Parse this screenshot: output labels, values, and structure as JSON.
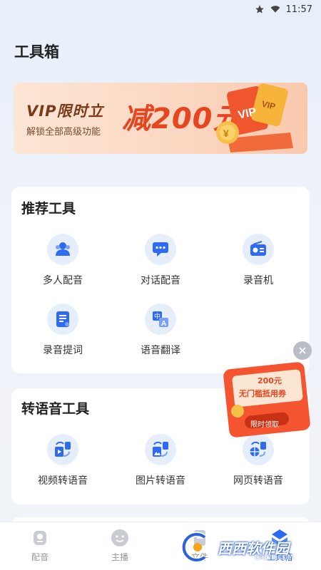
{
  "status_bar": {
    "time": "11:57"
  },
  "page": {
    "title": "工具箱"
  },
  "banner": {
    "headline": "VIP限时立",
    "subtitle": "解锁全部高级功能",
    "promo": "减200元",
    "badge_text": "VIP"
  },
  "recommended": {
    "title": "推荐工具",
    "items": [
      {
        "label": "多人配音",
        "icon": "multi-person-icon"
      },
      {
        "label": "对话配音",
        "icon": "chat-bubble-icon"
      },
      {
        "label": "录音机",
        "icon": "recorder-icon"
      },
      {
        "label": "录音提词",
        "icon": "teleprompter-icon"
      },
      {
        "label": "语音翻译",
        "icon": "translate-icon"
      }
    ]
  },
  "to_speech": {
    "title": "转语音工具",
    "items": [
      {
        "label": "视频转语音",
        "icon": "video-to-speech-icon"
      },
      {
        "label": "图片转语音",
        "icon": "image-to-speech-icon"
      },
      {
        "label": "网页转语音",
        "icon": "web-to-speech-icon"
      }
    ]
  },
  "float_ad": {
    "amount": "200元",
    "coupon": "无门槛抵用券",
    "cta": "限时领取"
  },
  "tabbar": {
    "items": [
      {
        "label": "配音",
        "icon": "dub-icon",
        "active": false
      },
      {
        "label": "主播",
        "icon": "anchor-face-icon",
        "active": false
      },
      {
        "label": "文件",
        "icon": "file-icon",
        "active": false
      },
      {
        "label": "工具箱",
        "icon": "toolbox-icon",
        "active": true
      }
    ]
  },
  "watermark": {
    "text": "西西软件园",
    "url": "CR173.COM"
  },
  "colors": {
    "accent": "#2f6bf2",
    "icon_bg": "#e6eefc",
    "promo_red": "#e6461f"
  }
}
